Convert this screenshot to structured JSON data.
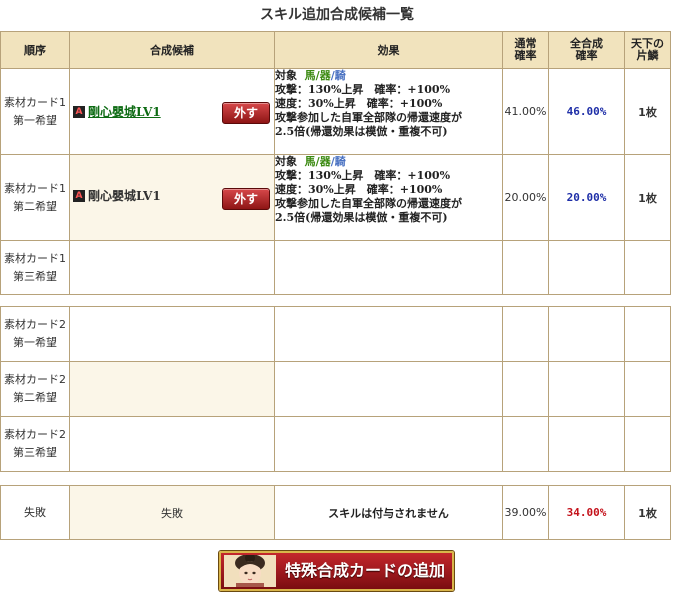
{
  "title": "スキル追加合成候補一覧",
  "headers": {
    "order": "順序",
    "candidate": "合成候補",
    "effect": "効果",
    "normal_rate_l1": "通常",
    "normal_rate_l2": "確率",
    "total_rate_l1": "合成",
    "total_rate_l1_prefix": "全",
    "total_rate_l2": "確率",
    "scale_l1": "天下の",
    "scale_l2": "片鱗"
  },
  "card1_rows": [
    {
      "order_l1": "素材カード1",
      "order_l2": "第一希望",
      "badge": "A",
      "skill": "剛心嬰城LV1",
      "remove": "外す",
      "effect": {
        "target_label": "対象",
        "t1": "馬",
        "sep1": "/",
        "t2": "器",
        "sep2": "/",
        "t3": "騎",
        "l2": "攻撃：130%上昇　確率：+100%",
        "l3": "速度：30%上昇　確率：+100%",
        "l4": "攻撃参加した自軍全部隊の帰還速度が",
        "l5": "2.5倍(帰還効果は模倣・重複不可)"
      },
      "normal_rate": "41.00%",
      "total_rate": "46.00%",
      "scale": "1枚"
    },
    {
      "order_l1": "素材カード1",
      "order_l2": "第二希望",
      "badge": "A",
      "skill": "剛心嬰城LV1",
      "remove": "外す",
      "effect": {
        "target_label": "対象",
        "t1": "馬",
        "sep1": "/",
        "t2": "器",
        "sep2": "/",
        "t3": "騎",
        "l2": "攻撃：130%上昇　確率：+100%",
        "l3": "速度：30%上昇　確率：+100%",
        "l4": "攻撃参加した自軍全部隊の帰還速度が",
        "l5": "2.5倍(帰還効果は模倣・重複不可)"
      },
      "normal_rate": "20.00%",
      "total_rate": "20.00%",
      "scale": "1枚"
    },
    {
      "order_l1": "素材カード1",
      "order_l2": "第三希望"
    }
  ],
  "card2_rows": [
    {
      "order_l1": "素材カード2",
      "order_l2": "第一希望"
    },
    {
      "order_l1": "素材カード2",
      "order_l2": "第二希望"
    },
    {
      "order_l1": "素材カード2",
      "order_l2": "第三希望"
    }
  ],
  "fail_row": {
    "order": "失敗",
    "candidate": "失敗",
    "effect": "スキルは付与されません",
    "normal_rate": "39.00%",
    "total_rate": "34.00%",
    "scale": "1枚"
  },
  "add_button": {
    "label": "特殊合成カードの追加"
  },
  "colors": {
    "header_bg": "#f1e3bd",
    "border": "#b7a27a",
    "link_green": "#0d6b13",
    "total_blue": "#1f2fa8",
    "total_red": "#c4121b",
    "button_red": "#c4262c"
  }
}
